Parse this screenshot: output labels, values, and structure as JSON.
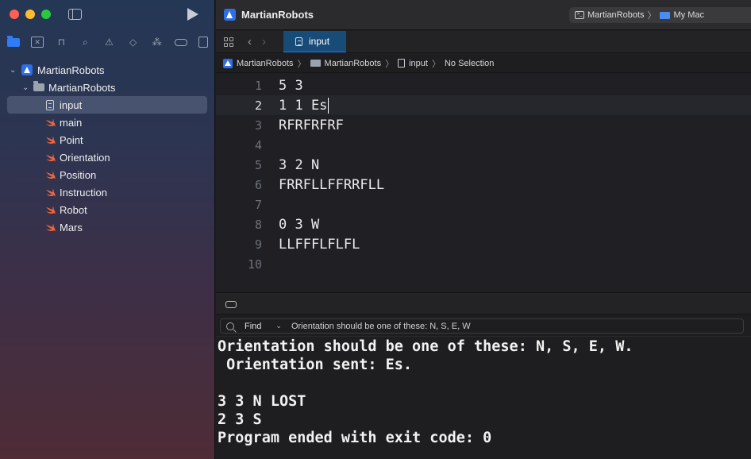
{
  "toolbar": {
    "title": "MartianRobots",
    "scheme": "MartianRobots",
    "destination": "My Mac"
  },
  "sidebar": {
    "project": "MartianRobots",
    "group": "MartianRobots",
    "files": [
      {
        "name": "input",
        "type": "file",
        "selected": true
      },
      {
        "name": "main",
        "type": "swift"
      },
      {
        "name": "Point",
        "type": "swift"
      },
      {
        "name": "Orientation",
        "type": "swift"
      },
      {
        "name": "Position",
        "type": "swift"
      },
      {
        "name": "Instruction",
        "type": "swift"
      },
      {
        "name": "Robot",
        "type": "swift"
      },
      {
        "name": "Mars",
        "type": "swift"
      }
    ]
  },
  "tab": {
    "label": "input"
  },
  "breadcrumb": [
    "MartianRobots",
    "MartianRobots",
    "input",
    "No Selection"
  ],
  "editor": {
    "current_line": 2,
    "lines": [
      {
        "n": "1",
        "text": "5 3"
      },
      {
        "n": "2",
        "text": "1 1 Es"
      },
      {
        "n": "3",
        "text": "RFRFRFRF"
      },
      {
        "n": "4",
        "text": ""
      },
      {
        "n": "5",
        "text": "3 2 N"
      },
      {
        "n": "6",
        "text": "FRRFLLFFRRFLL"
      },
      {
        "n": "7",
        "text": ""
      },
      {
        "n": "8",
        "text": "0 3 W"
      },
      {
        "n": "9",
        "text": "LLFFFLFLFL"
      },
      {
        "n": "10",
        "text": ""
      }
    ]
  },
  "find": {
    "mode": "Find",
    "query": "Orientation should be one of these: N, S, E, W"
  },
  "console": {
    "lines": [
      "Orientation should be one of these: N, S, E, W.",
      " Orientation sent: Es.",
      "",
      "3 3 N LOST",
      "2 3 S",
      "Program ended with exit code: 0"
    ]
  },
  "colors": {
    "accent": "#2f7cf6",
    "tab_active": "#174b78",
    "close": "#fe5f57",
    "minimize": "#febc2e",
    "zoom": "#28c840",
    "swift_orange": "#f0643c"
  }
}
